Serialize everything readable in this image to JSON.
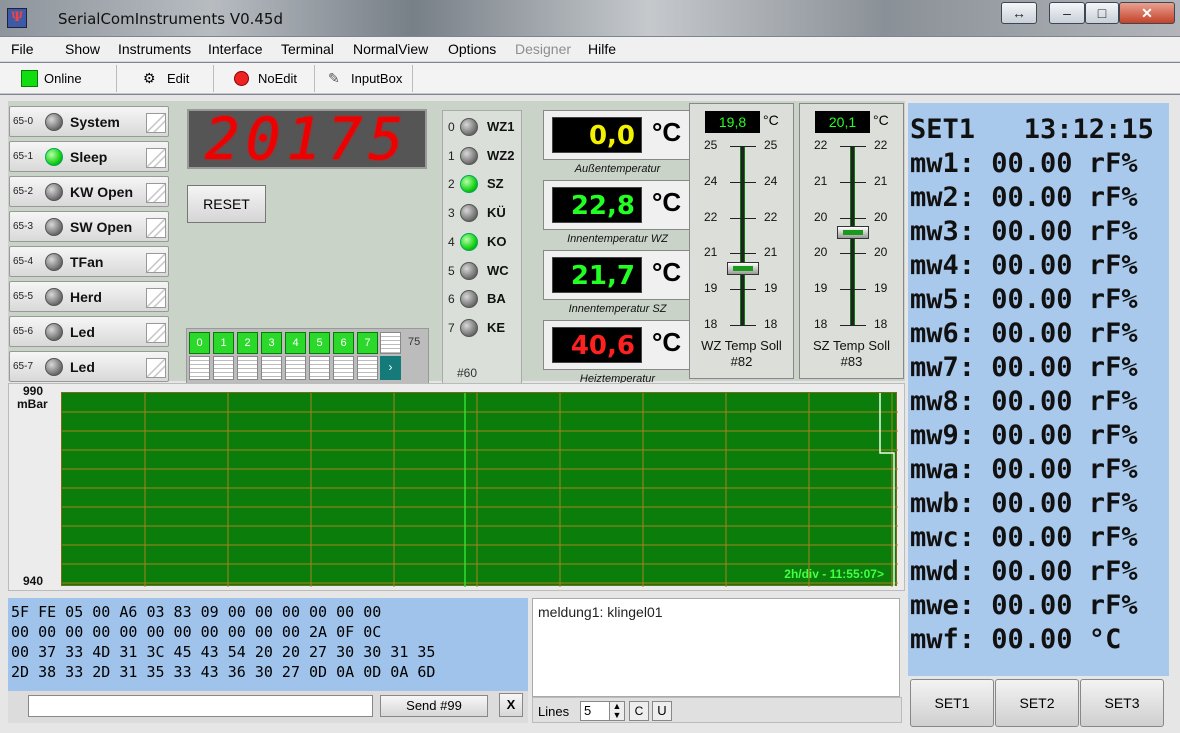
{
  "window": {
    "title": "SerialComInstruments  V0.45d",
    "icon": "app-icon",
    "buttons": [
      "↔",
      "–",
      "□",
      "✕"
    ]
  },
  "menu": [
    "File",
    "Show",
    "Instruments",
    "Interface",
    "Terminal",
    "NormalView",
    "Options",
    "Designer",
    "Hilfe"
  ],
  "toolbar": {
    "online": "Online",
    "edit": "Edit",
    "noedit": "NoEdit",
    "inputbox": "InputBox"
  },
  "switches": [
    {
      "addr": "65-0",
      "label": "System",
      "on": false
    },
    {
      "addr": "65-1",
      "label": "Sleep",
      "on": true
    },
    {
      "addr": "65-2",
      "label": "KW Open",
      "on": false
    },
    {
      "addr": "65-3",
      "label": "SW Open",
      "on": false
    },
    {
      "addr": "65-4",
      "label": "TFan",
      "on": false
    },
    {
      "addr": "65-5",
      "label": "Herd",
      "on": false
    },
    {
      "addr": "65-6",
      "label": "Led",
      "on": false
    },
    {
      "addr": "65-7",
      "label": "Led",
      "on": false
    }
  ],
  "segment_display": "20175",
  "reset_label": "RESET",
  "bits": [
    "0",
    "1",
    "2",
    "3",
    "4",
    "5",
    "6",
    "7"
  ],
  "bit_count": "75",
  "lamps": [
    {
      "n": "0",
      "label": "WZ1",
      "on": false
    },
    {
      "n": "1",
      "label": "WZ2",
      "on": false
    },
    {
      "n": "2",
      "label": "SZ",
      "on": true
    },
    {
      "n": "3",
      "label": "KÜ",
      "on": false
    },
    {
      "n": "4",
      "label": "KO",
      "on": true
    },
    {
      "n": "5",
      "label": "WC",
      "on": false
    },
    {
      "n": "6",
      "label": "BA",
      "on": false
    },
    {
      "n": "7",
      "label": "KE",
      "on": false
    }
  ],
  "lamp_panel_id": "#60",
  "temps": [
    {
      "value": "0,0",
      "unit": "°C",
      "caption": "Außentemperatur",
      "color": "#f2f200"
    },
    {
      "value": "22,8",
      "unit": "°C",
      "caption": "Innentemperatur WZ",
      "color": "#22ff22"
    },
    {
      "value": "21,7",
      "unit": "°C",
      "caption": "Innentemperatur SZ",
      "color": "#22ff22"
    },
    {
      "value": "40,6",
      "unit": "°C",
      "caption": "Heiztemperatur",
      "color": "#ff2020"
    }
  ],
  "sliders": [
    {
      "value": "19,8",
      "unit": "°C",
      "ticks": [
        "25",
        "24",
        "22",
        "21",
        "19",
        "18"
      ],
      "caption": "WZ Temp Soll",
      "id": "#82",
      "level": 0.32
    },
    {
      "value": "20,1",
      "unit": "°C",
      "ticks": [
        "22",
        "21",
        "20",
        "20",
        "19",
        "18"
      ],
      "caption": "SZ Temp Soll",
      "id": "#83",
      "level": 0.52
    }
  ],
  "graph": {
    "ymax": "990",
    "yunit": "mBar",
    "ymin": "940",
    "footer": "2h/div - 11:55:07>"
  },
  "hex_lines": [
    "5F FE 05 00 A6 03 83 09 00 00 00 00 00 00",
    "00 00 00 00 00 00 00 00 00 00 00 2A 0F 0C",
    "00 37 33 4D 31 3C 45 43 54 20 20 27 30 30 31 35",
    "2D 38 33 2D 31 35 33 43 36 30 27 0D 0A 0D 0A 6D"
  ],
  "send": {
    "label": "Send #99",
    "clear": "X"
  },
  "message": "meldung1: klingel01",
  "lines": {
    "label": "Lines",
    "value": "5",
    "c": "C",
    "u": "U"
  },
  "readout": [
    "SET1   13:12:15",
    "mw1: 00.00 rF%",
    "mw2: 00.00 rF%",
    "mw3: 00.00 rF%",
    "mw4: 00.00 rF%",
    "mw5: 00.00 rF%",
    "mw6: 00.00 rF%",
    "mw7: 00.00 rF%",
    "mw8: 00.00 rF%",
    "mw9: 00.00 rF%",
    "mwa: 00.00 rF%",
    "mwb: 00.00 rF%",
    "mwc: 00.00 rF%",
    "mwd: 00.00 rF%",
    "mwe: 00.00 rF%",
    "mwf: 00.00 °C"
  ],
  "set_buttons": [
    "SET1",
    "SET2",
    "SET3"
  ]
}
